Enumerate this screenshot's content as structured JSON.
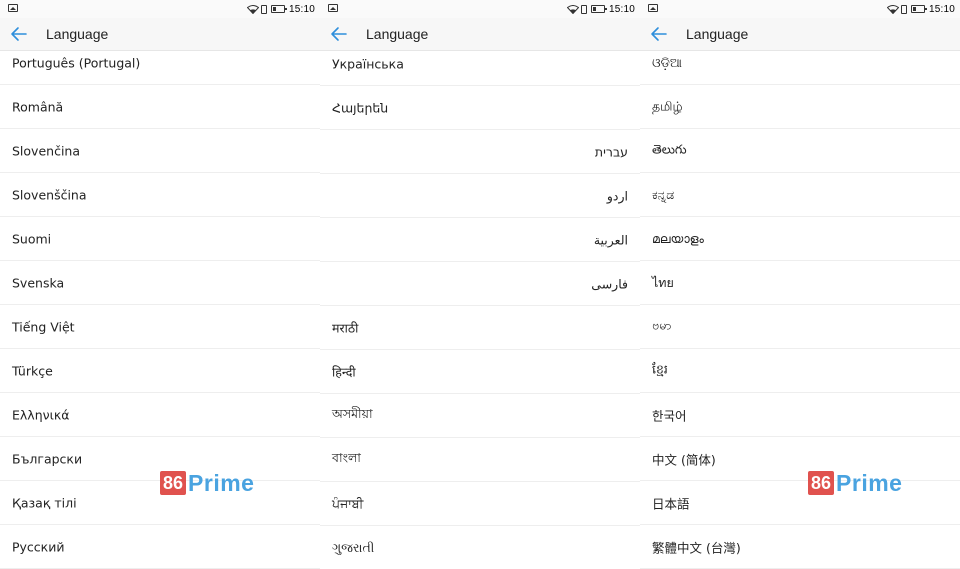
{
  "status": {
    "time": "15:10"
  },
  "header": {
    "title": "Language"
  },
  "screens": [
    {
      "items": [
        {
          "label": "Português (Portugal)",
          "dir": "ltr"
        },
        {
          "label": "Română",
          "dir": "ltr"
        },
        {
          "label": "Slovenčina",
          "dir": "ltr"
        },
        {
          "label": "Slovenščina",
          "dir": "ltr"
        },
        {
          "label": "Suomi",
          "dir": "ltr"
        },
        {
          "label": "Svenska",
          "dir": "ltr"
        },
        {
          "label": "Tiếng Việt",
          "dir": "ltr"
        },
        {
          "label": "Türkçe",
          "dir": "ltr"
        },
        {
          "label": "Ελληνικά",
          "dir": "ltr"
        },
        {
          "label": "Български",
          "dir": "ltr"
        },
        {
          "label": "Қазақ тілі",
          "dir": "ltr"
        },
        {
          "label": "Русский",
          "dir": "ltr"
        }
      ]
    },
    {
      "items": [
        {
          "label": "Українська",
          "dir": "ltr"
        },
        {
          "label": "Հայերեն",
          "dir": "ltr"
        },
        {
          "label": "עברית",
          "dir": "rtl"
        },
        {
          "label": "اردو",
          "dir": "rtl"
        },
        {
          "label": "العربية",
          "dir": "rtl"
        },
        {
          "label": "فارسی",
          "dir": "rtl"
        },
        {
          "label": "मराठी",
          "dir": "ltr"
        },
        {
          "label": "हिन्दी",
          "dir": "ltr"
        },
        {
          "label": "অসমীয়া",
          "dir": "ltr"
        },
        {
          "label": "বাংলা",
          "dir": "ltr"
        },
        {
          "label": "ਪੰਜਾਬੀ",
          "dir": "ltr"
        },
        {
          "label": "ગુજરાતી",
          "dir": "ltr"
        }
      ]
    },
    {
      "items": [
        {
          "label": "ଓଡ଼ିଆ",
          "dir": "ltr"
        },
        {
          "label": "தமிழ்",
          "dir": "ltr"
        },
        {
          "label": "తెలుగు",
          "dir": "ltr"
        },
        {
          "label": "ಕನ್ನಡ",
          "dir": "ltr"
        },
        {
          "label": "മലയാളം",
          "dir": "ltr"
        },
        {
          "label": "ไทย",
          "dir": "ltr"
        },
        {
          "label": "ဗမာ",
          "dir": "ltr"
        },
        {
          "label": "ខ្មែរ",
          "dir": "ltr"
        },
        {
          "label": "한국어",
          "dir": "ltr"
        },
        {
          "label": "中文 (简体)",
          "dir": "ltr"
        },
        {
          "label": "日本語",
          "dir": "ltr"
        },
        {
          "label": "繁體中文 (台灣)",
          "dir": "ltr"
        }
      ]
    }
  ],
  "watermark": {
    "number": "86",
    "word": "Prime"
  },
  "colors": {
    "accent": "#2f8fdc",
    "watermark_red": "#e0524e",
    "watermark_blue": "#4aa3e0"
  },
  "icons": {
    "back": "arrow-left-icon",
    "wifi": "wifi-icon",
    "sim": "sim-icon",
    "battery": "battery-icon",
    "image": "image-icon"
  }
}
